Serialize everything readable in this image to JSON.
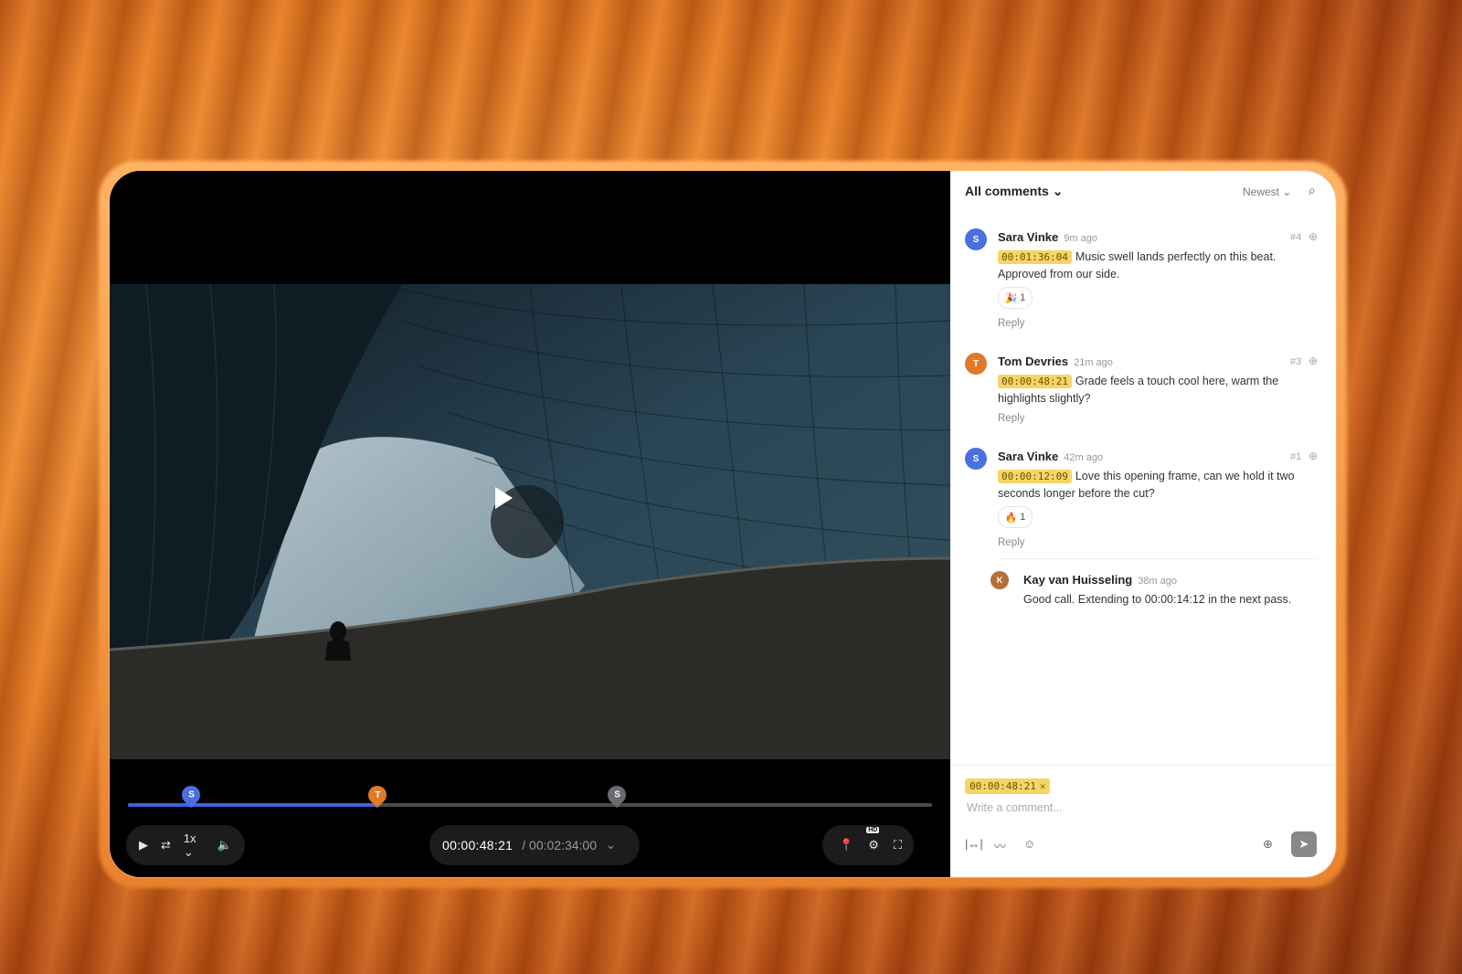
{
  "player": {
    "timecode_current": "00:00:48:21",
    "timecode_total": "/ 00:02:34:00",
    "speed": "1x",
    "progress": 0.31,
    "hd_badge": "HD",
    "markers": [
      {
        "initial": "S",
        "color": "#4a6fe0",
        "position": 0.078
      },
      {
        "initial": "T",
        "color": "#e07a2a",
        "position": 0.31
      },
      {
        "initial": "S",
        "color": "#6a6a72",
        "position": 0.608
      }
    ]
  },
  "comments_panel": {
    "title": "All comments",
    "sort": "Newest",
    "comments": [
      {
        "initial": "S",
        "color": "#4a6fe0",
        "author": "Sara Vinke",
        "time": "9m ago",
        "number": "#4",
        "timestamp": "00:01:36:04",
        "text": "Music swell lands perfectly on this beat. Approved from our side.",
        "reaction": "🎉",
        "reaction_count": "1",
        "reply": "Reply"
      },
      {
        "initial": "T",
        "color": "#e07a2a",
        "author": "Tom Devries",
        "time": "21m ago",
        "number": "#3",
        "timestamp": "00:00:48:21",
        "text": "Grade feels a touch cool here, warm the highlights slightly?",
        "reply": "Reply"
      },
      {
        "initial": "S",
        "color": "#4a6fe0",
        "author": "Sara Vinke",
        "time": "42m ago",
        "number": "#1",
        "timestamp": "00:00:12:09",
        "text": "Love this opening frame, can we hold it two seconds longer before the cut?",
        "reaction": "🔥",
        "reaction_count": "1",
        "reply": "Reply"
      }
    ],
    "nested_reply": {
      "initial": "K",
      "color": "#b5703a",
      "author": "Kay van Huisseling",
      "time": "38m ago",
      "text": "Good call. Extending to 00:00:14:12 in the next pass."
    },
    "composer": {
      "timestamp_chip": "00:00:48:21",
      "chip_remove": "×",
      "placeholder": "Write a comment..."
    }
  }
}
